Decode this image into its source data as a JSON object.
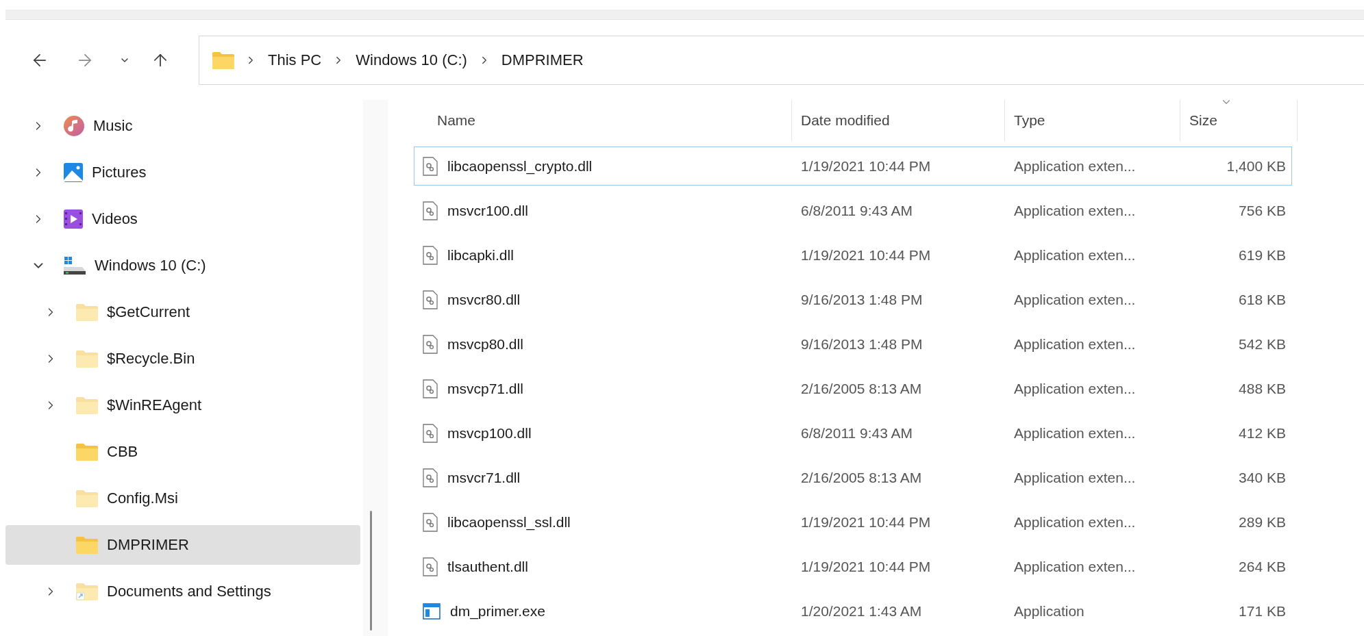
{
  "address_bar": {
    "segments": [
      "This PC",
      "Windows 10 (C:)",
      "DMPRIMER"
    ]
  },
  "sidebar": {
    "items": [
      {
        "label": "Music",
        "kind": "music",
        "expanded": false,
        "selected": false
      },
      {
        "label": "Pictures",
        "kind": "pictures",
        "expanded": false,
        "selected": false
      },
      {
        "label": "Videos",
        "kind": "videos",
        "expanded": false,
        "selected": false
      },
      {
        "label": "Windows 10 (C:)",
        "kind": "drive",
        "expanded": true,
        "selected": false,
        "children": [
          {
            "label": "$GetCurrent",
            "kind": "folder",
            "hidden": true,
            "expanded": false,
            "selected": false
          },
          {
            "label": "$Recycle.Bin",
            "kind": "folder",
            "hidden": true,
            "expanded": false,
            "selected": false
          },
          {
            "label": "$WinREAgent",
            "kind": "folder",
            "hidden": true,
            "expanded": false,
            "selected": false
          },
          {
            "label": "CBB",
            "kind": "folder",
            "hidden": false,
            "selected": false
          },
          {
            "label": "Config.Msi",
            "kind": "folder",
            "hidden": true,
            "selected": false
          },
          {
            "label": "DMPRIMER",
            "kind": "folder",
            "hidden": false,
            "selected": true
          },
          {
            "label": "Documents and Settings",
            "kind": "shortcut",
            "hidden": true,
            "expanded": false,
            "selected": false
          }
        ]
      }
    ]
  },
  "file_list": {
    "columns": [
      {
        "label": "Name",
        "sorted": false
      },
      {
        "label": "Date modified",
        "sorted": false
      },
      {
        "label": "Type",
        "sorted": false
      },
      {
        "label": "Size",
        "sorted": true
      }
    ],
    "rows": [
      {
        "name": "libcaopenssl_crypto.dll",
        "date": "1/19/2021 10:44 PM",
        "type": "Application exten...",
        "size": "1,400 KB",
        "kind": "dll",
        "focused": true
      },
      {
        "name": "msvcr100.dll",
        "date": "6/8/2011 9:43 AM",
        "type": "Application exten...",
        "size": "756 KB",
        "kind": "dll",
        "focused": false
      },
      {
        "name": "libcapki.dll",
        "date": "1/19/2021 10:44 PM",
        "type": "Application exten...",
        "size": "619 KB",
        "kind": "dll",
        "focused": false
      },
      {
        "name": "msvcr80.dll",
        "date": "9/16/2013 1:48 PM",
        "type": "Application exten...",
        "size": "618 KB",
        "kind": "dll",
        "focused": false
      },
      {
        "name": "msvcp80.dll",
        "date": "9/16/2013 1:48 PM",
        "type": "Application exten...",
        "size": "542 KB",
        "kind": "dll",
        "focused": false
      },
      {
        "name": "msvcp71.dll",
        "date": "2/16/2005 8:13 AM",
        "type": "Application exten...",
        "size": "488 KB",
        "kind": "dll",
        "focused": false
      },
      {
        "name": "msvcp100.dll",
        "date": "6/8/2011 9:43 AM",
        "type": "Application exten...",
        "size": "412 KB",
        "kind": "dll",
        "focused": false
      },
      {
        "name": "msvcr71.dll",
        "date": "2/16/2005 8:13 AM",
        "type": "Application exten...",
        "size": "340 KB",
        "kind": "dll",
        "focused": false
      },
      {
        "name": "libcaopenssl_ssl.dll",
        "date": "1/19/2021 10:44 PM",
        "type": "Application exten...",
        "size": "289 KB",
        "kind": "dll",
        "focused": false
      },
      {
        "name": "tlsauthent.dll",
        "date": "1/19/2021 10:44 PM",
        "type": "Application exten...",
        "size": "264 KB",
        "kind": "dll",
        "focused": false
      },
      {
        "name": "dm_primer.exe",
        "date": "1/20/2021 1:43 AM",
        "type": "Application",
        "size": "171 KB",
        "kind": "exe",
        "focused": false
      }
    ]
  }
}
